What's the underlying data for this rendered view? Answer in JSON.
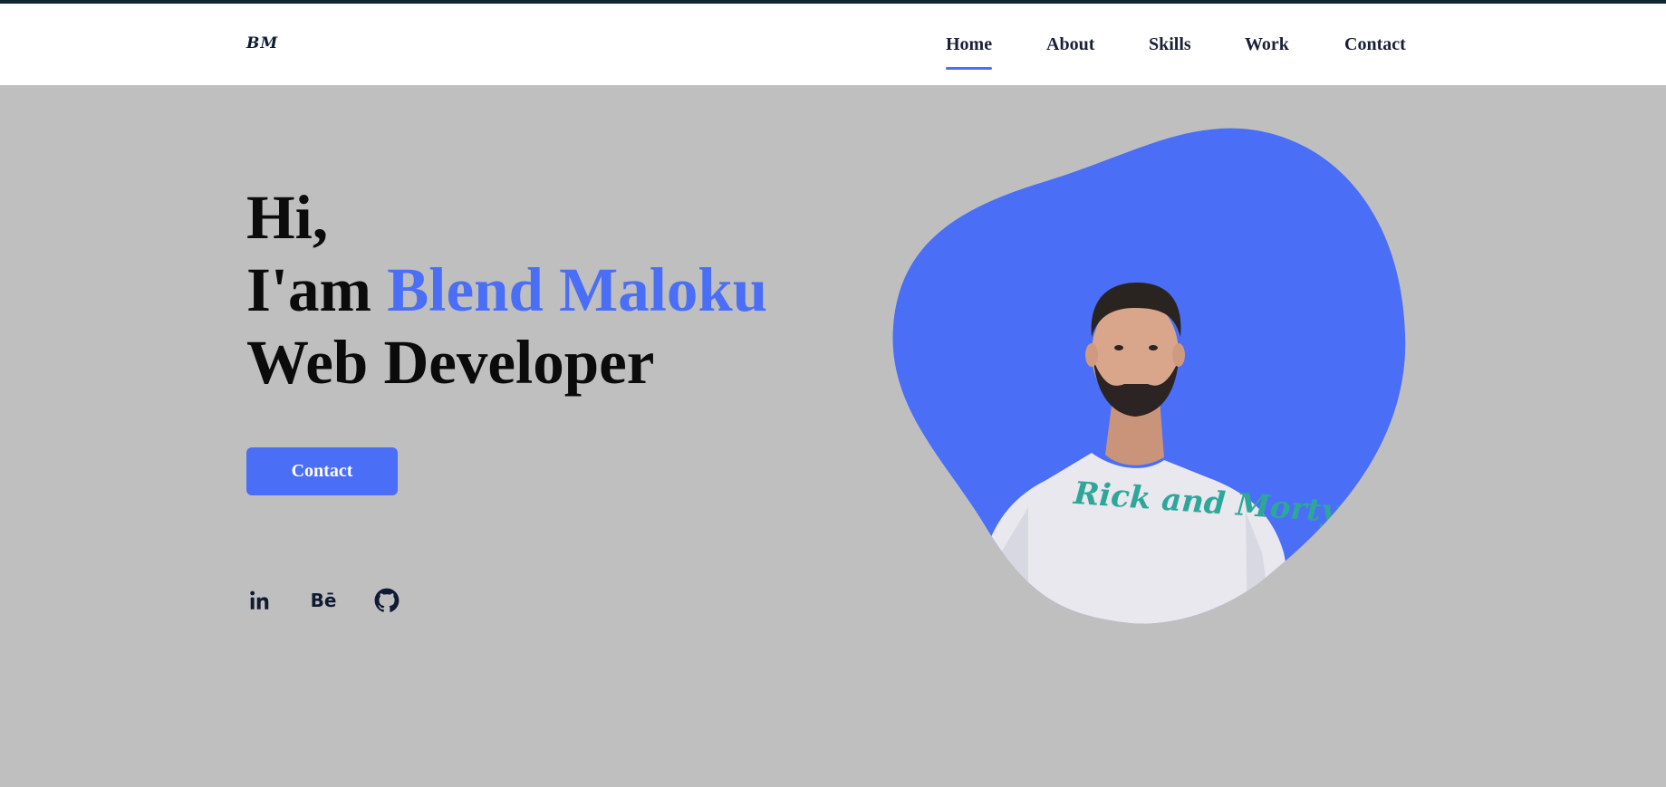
{
  "brand": {
    "logo_text": "BM"
  },
  "nav": {
    "items": [
      {
        "label": "Home",
        "active": true
      },
      {
        "label": "About",
        "active": false
      },
      {
        "label": "Skills",
        "active": false
      },
      {
        "label": "Work",
        "active": false
      },
      {
        "label": "Contact",
        "active": false
      }
    ]
  },
  "hero": {
    "greeting": "Hi,",
    "intro_prefix": "I'am ",
    "name": "Blend Maloku",
    "role": "Web Developer",
    "cta_label": "Contact",
    "shirt_text": "Rick and Morty"
  },
  "socials": [
    {
      "icon": "linkedin-icon"
    },
    {
      "icon": "behance-icon",
      "text": "Bē"
    },
    {
      "icon": "github-icon"
    }
  ],
  "colors": {
    "accent": "#4a6ef5",
    "background": "#bfbfbf",
    "header_bg": "#ffffff",
    "text_dark": "#0b0b0b",
    "nav_text": "#1b2038",
    "top_line": "#0e2631"
  }
}
